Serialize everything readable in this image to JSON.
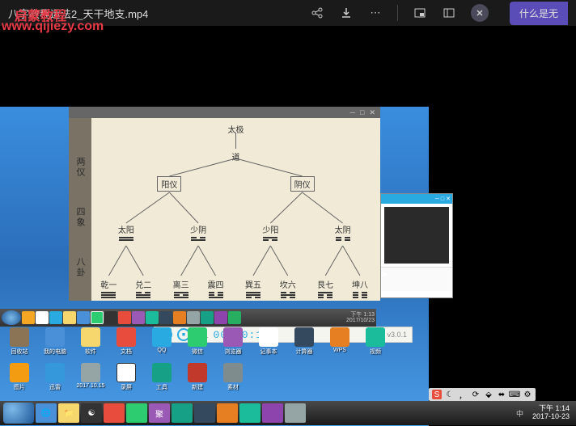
{
  "topbar": {
    "title": "八字教程运法2_天干地支.mp4",
    "right_label": "什么是无"
  },
  "watermark": {
    "line1": "启蒙教程",
    "line2": "www.qijiezy.com"
  },
  "diagram": {
    "root": "太极",
    "dao": "道",
    "sidebar": [
      "两仪",
      "四象",
      "八卦"
    ],
    "liangyi": [
      "阳仪",
      "阴仪"
    ],
    "sixiang": [
      "太阳",
      "少阴",
      "少阳",
      "太阴"
    ],
    "bagua": [
      "乾一",
      "兑二",
      "离三",
      "震四",
      "巽五",
      "坎六",
      "艮七",
      "坤八"
    ]
  },
  "media": {
    "timer": "00:00:10",
    "version": "v3.0.1",
    "prefix": "录..."
  },
  "inner_taskbar": {
    "time": "下午 1:13",
    "date": "2017/10/23"
  },
  "outer_taskbar": {
    "time": "下午 1:14",
    "date": "2017-10-23",
    "ime": "中"
  },
  "desktop_icons": [
    "回收站",
    "我的电脑",
    "软件",
    "文档",
    "QQ",
    "微信",
    "浏览器",
    "记事本",
    "计算器",
    "WPS",
    "视频",
    "图片",
    "迅雷",
    "2017.10.15",
    "录屏",
    "工具",
    "新建",
    "素材"
  ],
  "tray_icon": "S"
}
